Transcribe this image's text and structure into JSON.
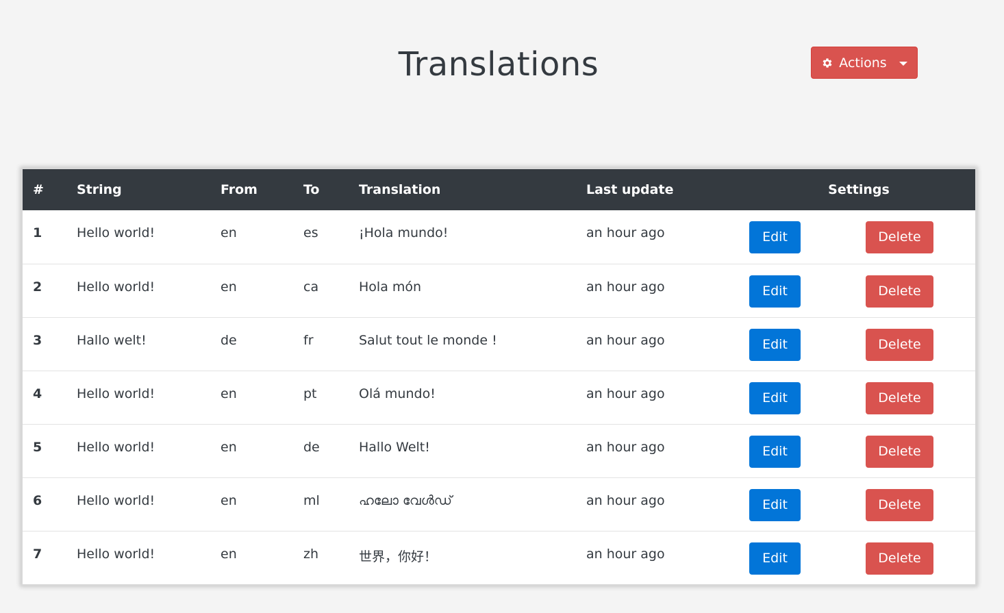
{
  "header": {
    "title": "Translations",
    "actions_label": "Actions"
  },
  "colors": {
    "primary": "#0275d8",
    "danger": "#d9534f",
    "dark": "#343a40",
    "background": "#f4f4f4"
  },
  "table": {
    "columns": [
      "#",
      "String",
      "From",
      "To",
      "Translation",
      "Last update",
      "Settings"
    ],
    "edit_label": "Edit",
    "delete_label": "Delete",
    "rows": [
      {
        "id": "1",
        "string": "Hello world!",
        "from": "en",
        "to": "es",
        "translation": "¡Hola mundo!",
        "updated": "an hour ago"
      },
      {
        "id": "2",
        "string": "Hello world!",
        "from": "en",
        "to": "ca",
        "translation": "Hola món",
        "updated": "an hour ago"
      },
      {
        "id": "3",
        "string": "Hallo welt!",
        "from": "de",
        "to": "fr",
        "translation": "Salut tout le monde !",
        "updated": "an hour ago"
      },
      {
        "id": "4",
        "string": "Hello world!",
        "from": "en",
        "to": "pt",
        "translation": "Olá mundo!",
        "updated": "an hour ago"
      },
      {
        "id": "5",
        "string": "Hello world!",
        "from": "en",
        "to": "de",
        "translation": "Hallo Welt!",
        "updated": "an hour ago"
      },
      {
        "id": "6",
        "string": "Hello world!",
        "from": "en",
        "to": "ml",
        "translation": "ഹലോ വേൾഡ്",
        "updated": "an hour ago"
      },
      {
        "id": "7",
        "string": "Hello world!",
        "from": "en",
        "to": "zh",
        "translation": "世界，你好！",
        "updated": "an hour ago"
      }
    ]
  }
}
